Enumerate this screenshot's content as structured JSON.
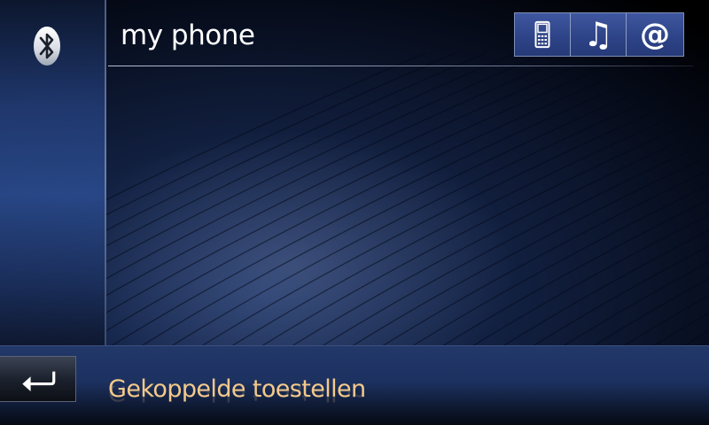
{
  "header": {
    "title": "my phone",
    "bluetooth_icon": "bluetooth-icon"
  },
  "mode_buttons": [
    {
      "icon": "mobile-phone-icon",
      "glyph": "▯"
    },
    {
      "icon": "music-note-icon",
      "glyph": "♫"
    },
    {
      "icon": "at-sign-icon",
      "glyph": "@"
    }
  ],
  "footer": {
    "back_icon": "back-arrow-icon",
    "status_text": "Gekoppelde toestellen"
  },
  "colors": {
    "accent_text": "#f3c98c",
    "button_blue": "#2e4488",
    "background_dark": "#050a17"
  }
}
